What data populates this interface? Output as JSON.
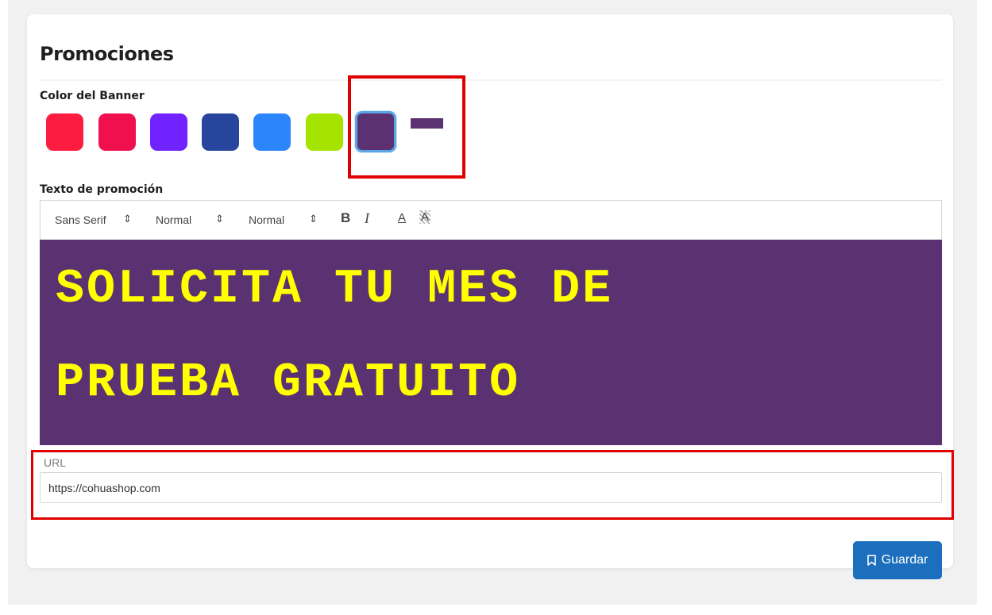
{
  "card": {
    "title": "Promociones",
    "color_label": "Color del Banner",
    "text_label": "Texto de promoción"
  },
  "colors": {
    "swatches": [
      "#fb1c3f",
      "#f0104d",
      "#7022ff",
      "#27459d",
      "#2b85fb",
      "#a5e400",
      "#5c3172"
    ],
    "selected_index": 6,
    "selected_preview": "#5c3172",
    "highlight": "#e00000",
    "editor_background": "#5a3272",
    "editor_text": "#ffff00",
    "button": "#1b6fbd"
  },
  "toolbar": {
    "font_select": "Sans Serif",
    "size_select": "Normal",
    "header_select": "Normal",
    "bold_label": "B",
    "italic_label": "I",
    "text_color_label": "A",
    "background_color_label": "A",
    "arrow": "⇕"
  },
  "editor": {
    "line1": "SOLICITA TU MES DE",
    "line2": "PRUEBA GRATUITO"
  },
  "url": {
    "label": "URL",
    "value": "https://cohuashop.com"
  },
  "save": {
    "label": "Guardar",
    "icon": "bookmark-icon"
  }
}
